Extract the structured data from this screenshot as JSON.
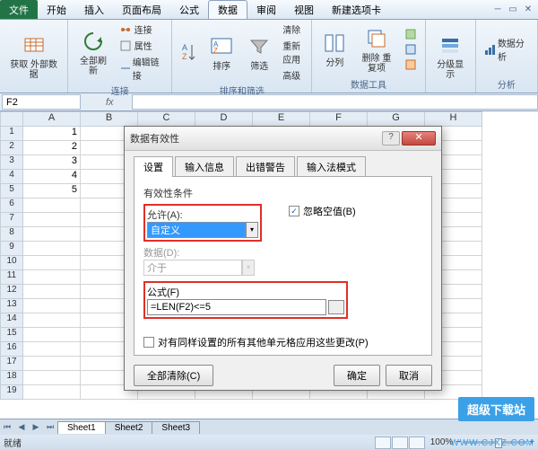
{
  "ribbon": {
    "file": "文件",
    "tabs": [
      "开始",
      "插入",
      "页面布局",
      "公式",
      "数据",
      "审阅",
      "视图",
      "新建选项卡"
    ],
    "active_tab_index": 4,
    "groups": {
      "get_data": {
        "btn": "获取\n外部数据",
        "title": ""
      },
      "connections": {
        "refresh": "全部刷新",
        "link": "连接",
        "prop": "属性",
        "editlink": "编辑链接",
        "title": "连接"
      },
      "sort_filter": {
        "sort": "排序",
        "filter": "筛选",
        "clear": "清除",
        "reapply": "重新应用",
        "advanced": "高级",
        "title": "排序和筛选"
      },
      "data_tools": {
        "text_cols": "分列",
        "remove_dup": "删除\n重复项",
        "title": "数据工具"
      },
      "outline": {
        "group": "分级显示",
        "title": ""
      },
      "analysis": {
        "btn": "数据分析",
        "title": "分析"
      }
    }
  },
  "namebox": {
    "cell": "F2",
    "fx": "fx"
  },
  "columns": [
    "A",
    "B",
    "C",
    "D",
    "E",
    "F",
    "G",
    "H"
  ],
  "rows": 19,
  "data_a": [
    "1",
    "2",
    "3",
    "4",
    "5"
  ],
  "sheets": [
    "Sheet1",
    "Sheet2",
    "Sheet3"
  ],
  "status": {
    "ready": "就绪",
    "zoom": "100%"
  },
  "dialog": {
    "title": "数据有效性",
    "tabs": [
      "设置",
      "输入信息",
      "出错警告",
      "输入法模式"
    ],
    "active": 0,
    "fieldset": "有效性条件",
    "allow_label": "允许(A):",
    "allow_value": "自定义",
    "ignore_blank": "忽略空值(B)",
    "data_label": "数据(D):",
    "data_value": "介于",
    "formula_label": "公式(F)",
    "formula_value": "=LEN(F2)<=5",
    "apply_same": "对有同样设置的所有其他单元格应用这些更改(P)",
    "clear_all": "全部清除(C)",
    "ok": "确定",
    "cancel": "取消"
  },
  "watermark": {
    "brand": "超级下载站",
    "url": "WWW.CJXZ.COM"
  }
}
